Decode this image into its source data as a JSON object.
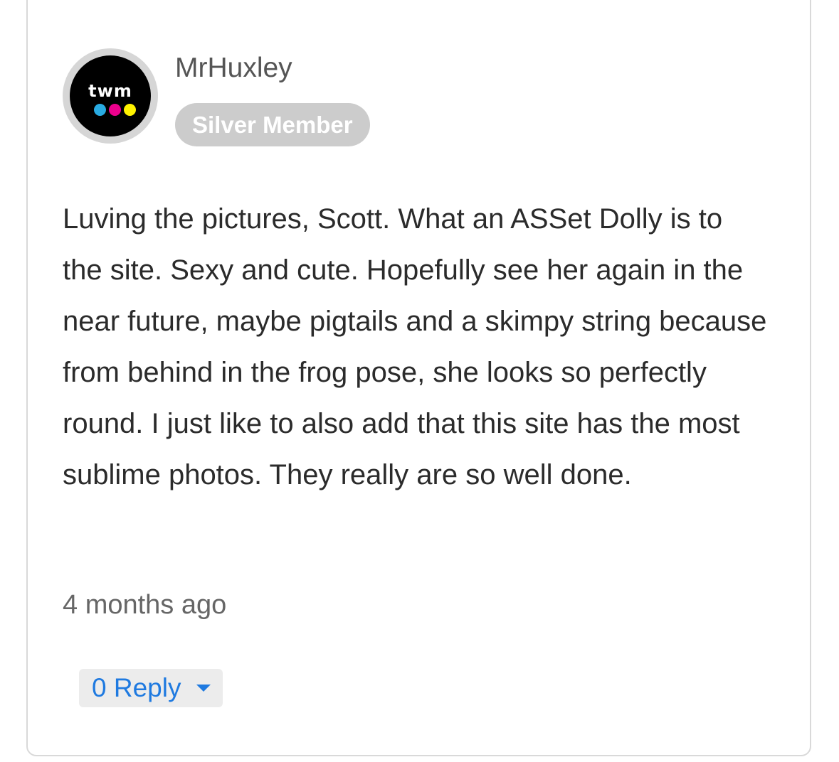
{
  "comment": {
    "avatar": {
      "logo_text": "twm",
      "dot_colors": [
        "#29abe2",
        "#ec008c",
        "#fff200"
      ]
    },
    "username": "MrHuxley",
    "badge": "Silver Member",
    "body": "Luving the pictures, Scott. What an ASSet Dolly is to the site. Sexy and cute. Hopefully see her again in the near future, maybe pigtails and a skimpy string because from behind in the frog pose, she looks so perfectly round. I just like to also add that this site has the most sublime photos. They really are so well done.",
    "timestamp": "4 months ago",
    "reply_button": {
      "count": "0",
      "label": "Reply"
    },
    "colors": {
      "badge_bg": "#cccccc",
      "link_blue": "#1f7ae0",
      "reply_bg": "#ececec"
    }
  }
}
